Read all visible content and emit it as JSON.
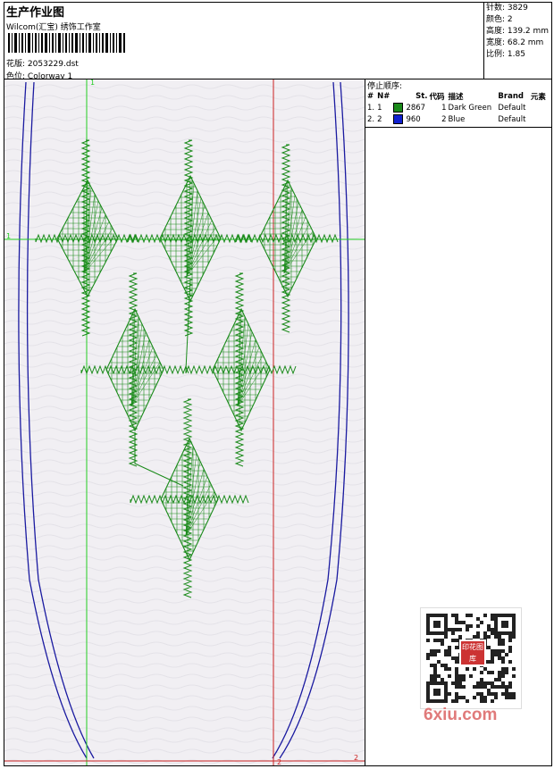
{
  "header": {
    "title": "生产作业图",
    "studio": "Wilcom(汇宝) 绣饰工作室",
    "design_label": "花版:",
    "design_value": "2053229.dst",
    "colorway_label": "色位:",
    "colorway_value": "Colorway 1"
  },
  "stats": {
    "stitches": "针数: 3829",
    "colors": "颜色: 2",
    "height": "高度: 139.2 mm",
    "width": "宽度: 68.2 mm",
    "scale": "比例: 1.85"
  },
  "stop_sequence": {
    "title": "停止顺序:",
    "columns": [
      "#",
      "N#",
      "St.",
      "代码",
      "描述",
      "Brand",
      "元素"
    ],
    "rows": [
      {
        "idx": "1.",
        "n": "1",
        "color": "#1a8a1a",
        "stitches": "2867",
        "code": "1",
        "desc": "Dark Green",
        "brand": "Default"
      },
      {
        "idx": "2.",
        "n": "2",
        "color": "#1020d0",
        "stitches": "960",
        "code": "2",
        "desc": "Blue",
        "brand": "Default"
      }
    ]
  },
  "canvas": {
    "marker_top_left": "1",
    "marker_left": "1",
    "marker_bottom_2a": "2",
    "marker_bottom_2b": "2",
    "guide_green": "#22cc22",
    "guide_red": "#cc2222",
    "outline_blue": "#1a1aa0",
    "stitch_green": "#1a8a1a"
  },
  "watermark": {
    "site": "6xiu.com",
    "badge": "印花图库"
  }
}
